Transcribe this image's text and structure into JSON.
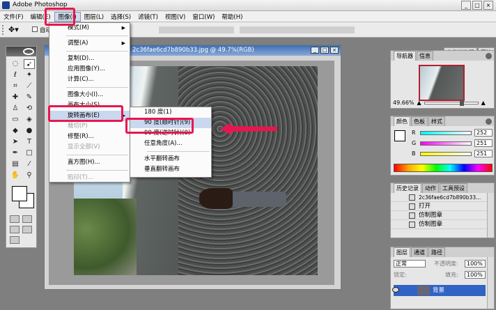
{
  "window": {
    "title": "Adobe Photoshop",
    "controls": [
      "_",
      "□",
      "×"
    ]
  },
  "menubar": [
    "文件(F)",
    "编辑(E)",
    "图像(I)",
    "图层(L)",
    "选择(S)",
    "滤镜(T)",
    "视图(V)",
    "窗口(W)",
    "帮助(H)"
  ],
  "options_bar": {
    "auto_select": "自动"
  },
  "panel_well": [
    "文件浏览器",
    "画笔"
  ],
  "document": {
    "title": "2c36fae6cd7b890b33.jpg @ 49.7%(RGB)"
  },
  "image_menu": {
    "items": [
      {
        "label": "模式(M)",
        "submenu": true,
        "enabled": true
      },
      {
        "sep": true
      },
      {
        "label": "调整(A)",
        "submenu": true,
        "enabled": true
      },
      {
        "sep": true
      },
      {
        "label": "复制(D)...",
        "enabled": true
      },
      {
        "label": "应用图像(Y)...",
        "enabled": true
      },
      {
        "label": "计算(C)...",
        "enabled": true
      },
      {
        "sep": true
      },
      {
        "label": "图像大小(I)...",
        "enabled": true
      },
      {
        "label": "画布大小(S)...",
        "enabled": true
      },
      {
        "label": "旋转画布(E)",
        "submenu": true,
        "enabled": true,
        "highlighted": true
      },
      {
        "label": "裁切(P)",
        "enabled": false
      },
      {
        "label": "修整(R)...",
        "enabled": true
      },
      {
        "label": "显示全部(V)",
        "enabled": false
      },
      {
        "sep": true
      },
      {
        "label": "直方图(H)...",
        "enabled": true
      },
      {
        "sep": true
      },
      {
        "label": "陷印(T)...",
        "enabled": false
      }
    ]
  },
  "rotate_submenu": {
    "items": [
      {
        "label": "180 度(1)"
      },
      {
        "label": "90 度(顺时针)(9)",
        "highlighted": true
      },
      {
        "label": "90 度(逆时针)(0)"
      },
      {
        "label": "任意角度(A)..."
      },
      {
        "sep": true
      },
      {
        "label": "水平翻转画布"
      },
      {
        "label": "垂直翻转画布"
      }
    ]
  },
  "navigator": {
    "tabs": [
      "导航器",
      "信息"
    ],
    "zoom": "49.66%"
  },
  "color_panel": {
    "tabs": [
      "颜色",
      "色板",
      "样式"
    ],
    "channels": [
      {
        "label": "R",
        "value": "252",
        "color": "#ff0000"
      },
      {
        "label": "G",
        "value": "251",
        "color": "#00c000"
      },
      {
        "label": "B",
        "value": "251",
        "color": "#0000ff"
      }
    ]
  },
  "history_panel": {
    "tabs": [
      "历史记录",
      "动作",
      "工具预设"
    ],
    "snapshot": "2c36fae6cd7b890b33...",
    "items": [
      "打开",
      "仿制图章",
      "仿制图章"
    ]
  },
  "layers_panel": {
    "tabs": [
      "图层",
      "通道",
      "路径"
    ],
    "blend_mode": "正常",
    "opacity_label": "不透明度:",
    "opacity": "100%",
    "lock_label": "锁定:",
    "fill_label": "填充:",
    "fill": "100%",
    "layer_name": "背景"
  },
  "colors": {
    "accent_red": "#e8164f",
    "selection_blue": "#3163c5"
  }
}
